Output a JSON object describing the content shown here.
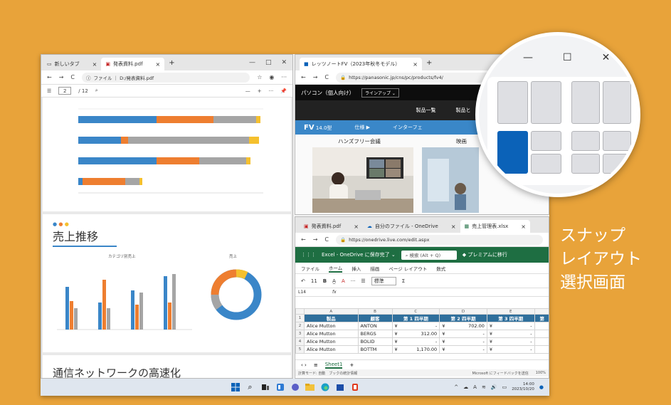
{
  "caption": {
    "line1": "スナップ",
    "line2": "レイアウト",
    "line3": "選択画面"
  },
  "pdf_window": {
    "tab1_label": "新しいタブ",
    "tab2_label": "発表資料.pdf",
    "url": "ファイル ｜ D:/発表資料.pdf",
    "page_current": "2",
    "page_total": "/ 12",
    "heading_sales": "売上推移",
    "chart1_title": "カテゴリ別売上",
    "chart2_title": "売上",
    "heading_network": "通信ネットワークの高速化"
  },
  "browser_window": {
    "tab_label": "レッツノートFV（2023年秋冬モデル）",
    "url": "https://panasonic.jp/cns/pc/products/fv4/",
    "nav_title": "パソコン（個人向け）",
    "nav_lineup": "ラインアップ ⌄",
    "menu_1": "製品一覧",
    "menu_2": "製品と",
    "fv_label": "FV",
    "fv_size": "14.0型",
    "fv_spec": "仕様 ▶",
    "fv_interface": "インターフェ",
    "feature_title": "ハンズフリー会議",
    "feature_title2": "映画"
  },
  "excel_window": {
    "tab1_label": "発表資料.pdf",
    "tab2_label": "自分のファイル - OneDrive",
    "tab3_label": "売上管理表.xlsx",
    "url": "https://onedrive.live.com/edit.aspx",
    "app_title": "Excel - OneDrive に保存完了 ⌄",
    "search_placeholder": "検索 (Alt + Q)",
    "premium": "プレミアムに移行",
    "ribbon_tabs": [
      "ファイル",
      "ホーム",
      "挿入",
      "描画",
      "ページ レイアウト",
      "数式"
    ],
    "font_size": "11",
    "number_format": "標準",
    "cell_ref": "L14",
    "fx": "fx",
    "col_headers": [
      "A",
      "B",
      "C",
      "D",
      "E"
    ],
    "header_row": [
      "製品",
      "顧客",
      "第 1 四半期",
      "第 2 四半期",
      "第 3 四半期",
      "第"
    ],
    "rows": [
      {
        "num": "2",
        "product": "Alice Mutton",
        "customer": "ANTON",
        "q1": "-",
        "q2": "702.00",
        "q3": "-"
      },
      {
        "num": "3",
        "product": "Alice Mutton",
        "customer": "BERGS",
        "q1": "312.00",
        "q2": "-",
        "q3": "-"
      },
      {
        "num": "4",
        "product": "Alice Mutton",
        "customer": "BOLID",
        "q1": "-",
        "q2": "-",
        "q3": "-"
      },
      {
        "num": "5",
        "product": "Alice Mutton",
        "customer": "BOTTM",
        "q1": "1,170.00",
        "q2": "-",
        "q3": "-"
      }
    ],
    "currency": "¥",
    "sheet_tab": "Sheet1",
    "status_left": "計算モード: 自動　ブックの統計情報",
    "status_right": "Microsoft にフィードバックを送信",
    "zoom": "100%"
  },
  "taskbar": {
    "time": "14:00",
    "date": "2023/10/20"
  },
  "colors": {
    "background": "#e8a33a",
    "excel_green": "#1e6e42",
    "accent_blue": "#0b62b8"
  }
}
